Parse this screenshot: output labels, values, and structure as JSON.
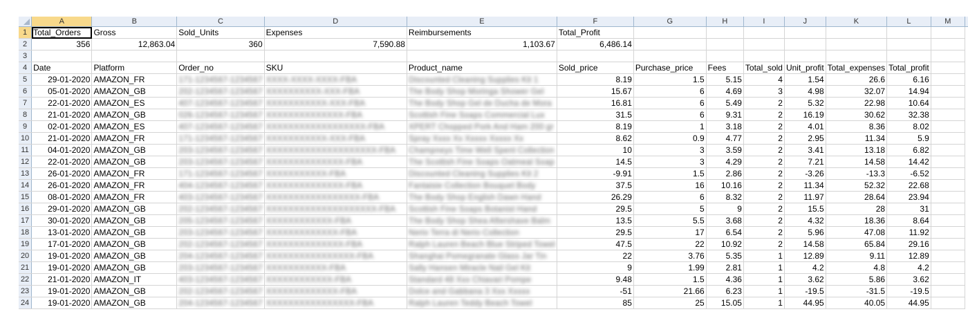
{
  "columns": [
    "A",
    "B",
    "C",
    "D",
    "E",
    "F",
    "G",
    "H",
    "I",
    "J",
    "K",
    "L",
    "M"
  ],
  "summary": {
    "headers": [
      "Total_Orders",
      "Gross",
      "Sold_Units",
      "Expenses",
      "Reimbursements",
      "Total_Profit"
    ],
    "values": [
      "356",
      "12,863.04",
      "360",
      "7,590.88",
      "1,103.67",
      "6,486.14"
    ]
  },
  "table": {
    "headers": [
      "Date",
      "Platform",
      "Order_no",
      "SKU",
      "Product_name",
      "Sold_price",
      "Purchase_price",
      "Fees",
      "Total_sold",
      "Unit_profit",
      "Total_expenses",
      "Total_profit"
    ],
    "rows": [
      {
        "date": "29-01-2020",
        "platform": "AMAZON_FR",
        "order": "171-1234567-1234567",
        "sku": "XXXX-XXXX-XXXX-FBA",
        "product": "Discounted Cleaning Supplies Kit 1",
        "sold": "8.19",
        "purchase": "1.5",
        "fees": "5.15",
        "total_sold": "4",
        "unit_profit": "1.54",
        "total_exp": "26.6",
        "total_profit": "6.16"
      },
      {
        "date": "05-01-2020",
        "platform": "AMAZON_GB",
        "order": "202-1234567-1234567",
        "sku": "XXXXXXXXXX-XXX-FBA",
        "product": "The Body Shop Moringa Shower Gel",
        "sold": "15.67",
        "purchase": "6",
        "fees": "4.69",
        "total_sold": "3",
        "unit_profit": "4.98",
        "total_exp": "32.07",
        "total_profit": "14.94"
      },
      {
        "date": "22-01-2020",
        "platform": "AMAZON_ES",
        "order": "407-1234567-1234567",
        "sku": "XXXXXXXXXXX-XXX-FBA",
        "product": "The Body Shop Gel de Ducha de Mora",
        "sold": "16.81",
        "purchase": "6",
        "fees": "5.49",
        "total_sold": "2",
        "unit_profit": "5.32",
        "total_exp": "22.98",
        "total_profit": "10.64"
      },
      {
        "date": "21-01-2020",
        "platform": "AMAZON_GB",
        "order": "026-1234567-1234567",
        "sku": "XXXXXXXXXXXXXX-FBA",
        "product": "Scottish Fine Soaps Commercial Lux",
        "sold": "31.5",
        "purchase": "6",
        "fees": "9.31",
        "total_sold": "2",
        "unit_profit": "16.19",
        "total_exp": "30.62",
        "total_profit": "32.38"
      },
      {
        "date": "02-01-2020",
        "platform": "AMAZON_ES",
        "order": "407-1234567-1234567",
        "sku": "XXXXXXXXXXXXXXXXXX-FBA",
        "product": "XPERT Chopped Pork And Ham 200 gr",
        "sold": "8.19",
        "purchase": "1",
        "fees": "3.18",
        "total_sold": "2",
        "unit_profit": "4.01",
        "total_exp": "8.36",
        "total_profit": "8.02"
      },
      {
        "date": "21-01-2020",
        "platform": "AMAZON_FR",
        "order": "171-1234567-1234567",
        "sku": "XXXXXXXXXXX-XXX-FBA",
        "product": "Spray Xxxx Xx Xxxxx Xxxxx Xx",
        "sold": "8.62",
        "purchase": "0.9",
        "fees": "4.77",
        "total_sold": "2",
        "unit_profit": "2.95",
        "total_exp": "11.34",
        "total_profit": "5.9"
      },
      {
        "date": "04-01-2020",
        "platform": "AMAZON_GB",
        "order": "203-1234567-1234567",
        "sku": "XXXXXXXXXXXXXXXXXXXX-FBA",
        "product": "Champneys Time Well Spent Collection",
        "sold": "10",
        "purchase": "3",
        "fees": "3.59",
        "total_sold": "2",
        "unit_profit": "3.41",
        "total_exp": "13.18",
        "total_profit": "6.82"
      },
      {
        "date": "22-01-2020",
        "platform": "AMAZON_GB",
        "order": "203-1234567-1234567",
        "sku": "XXXXXXXXXXXXXX-FBA",
        "product": "The Scottish Fine Soaps Oatmeal Soap",
        "sold": "14.5",
        "purchase": "3",
        "fees": "4.29",
        "total_sold": "2",
        "unit_profit": "7.21",
        "total_exp": "14.58",
        "total_profit": "14.42"
      },
      {
        "date": "26-01-2020",
        "platform": "AMAZON_FR",
        "order": "171-1234567-1234567",
        "sku": "XXXXXXXXXXX-FBA",
        "product": "Discounted Cleaning Supplies Kit 2",
        "sold": "-9.91",
        "purchase": "1.5",
        "fees": "2.86",
        "total_sold": "2",
        "unit_profit": "-3.26",
        "total_exp": "-13.3",
        "total_profit": "-6.52"
      },
      {
        "date": "26-01-2020",
        "platform": "AMAZON_FR",
        "order": "404-1234567-1234567",
        "sku": "XXXXXXXXXXXXXX-FBA",
        "product": "Fantaisie Collection Bouquet Body",
        "sold": "37.5",
        "purchase": "16",
        "fees": "10.16",
        "total_sold": "2",
        "unit_profit": "11.34",
        "total_exp": "52.32",
        "total_profit": "22.68"
      },
      {
        "date": "08-01-2020",
        "platform": "AMAZON_FR",
        "order": "403-1234567-1234567",
        "sku": "XXXXXXXXXXXXXXXXX-FBA",
        "product": "The Body Shop English Dawn Hand",
        "sold": "26.29",
        "purchase": "6",
        "fees": "8.32",
        "total_sold": "2",
        "unit_profit": "11.97",
        "total_exp": "28.64",
        "total_profit": "23.94"
      },
      {
        "date": "29-01-2020",
        "platform": "AMAZON_GB",
        "order": "202-1234567-1234567",
        "sku": "XXXXXXXXXXXXXXXXXXXX-FBA",
        "product": "Scottish Fine Soaps Botanist Hand",
        "sold": "29.5",
        "purchase": "5",
        "fees": "9",
        "total_sold": "2",
        "unit_profit": "15.5",
        "total_exp": "28",
        "total_profit": "31"
      },
      {
        "date": "30-01-2020",
        "platform": "AMAZON_GB",
        "order": "205-1234567-1234567",
        "sku": "XXXXXXXXXXXX-FBA",
        "product": "The Body Shop Shea Aftershave Balm",
        "sold": "13.5",
        "purchase": "5.5",
        "fees": "3.68",
        "total_sold": "2",
        "unit_profit": "4.32",
        "total_exp": "18.36",
        "total_profit": "8.64"
      },
      {
        "date": "13-01-2020",
        "platform": "AMAZON_GB",
        "order": "203-1234567-1234567",
        "sku": "XXXXXXXXXXXXX-FBA",
        "product": "Nerio Terra di Nerio Collection",
        "sold": "29.5",
        "purchase": "17",
        "fees": "6.54",
        "total_sold": "2",
        "unit_profit": "5.96",
        "total_exp": "47.08",
        "total_profit": "11.92"
      },
      {
        "date": "17-01-2020",
        "platform": "AMAZON_GB",
        "order": "202-1234567-1234567",
        "sku": "XXXXXXXXXXXXXX-FBA",
        "product": "Ralph Lauren Beach Blue Striped Towel",
        "sold": "47.5",
        "purchase": "22",
        "fees": "10.92",
        "total_sold": "2",
        "unit_profit": "14.58",
        "total_exp": "65.84",
        "total_profit": "29.16"
      },
      {
        "date": "19-01-2020",
        "platform": "AMAZON_GB",
        "order": "204-1234567-1234567",
        "sku": "XXXXXXXXXXXXXXXX-FBA",
        "product": "Shanghai Pomegranate Glass Jar Tin",
        "sold": "22",
        "purchase": "3.76",
        "fees": "5.35",
        "total_sold": "1",
        "unit_profit": "12.89",
        "total_exp": "9.11",
        "total_profit": "12.89"
      },
      {
        "date": "19-01-2020",
        "platform": "AMAZON_GB",
        "order": "203-1234567-1234567",
        "sku": "XXXXXXXXXXX-FBA",
        "product": "Sally Hansen Miracle Nail Gel Kit",
        "sold": "9",
        "purchase": "1.99",
        "fees": "2.81",
        "total_sold": "1",
        "unit_profit": "4.2",
        "total_exp": "4.8",
        "total_profit": "4.2"
      },
      {
        "date": "21-01-2020",
        "platform": "AMAZON_IT",
        "order": "403-1234567-1234567",
        "sku": "XXXXXXXXXXXX-FBA",
        "product": "Standard 48 Xxx Chiavari Pompe",
        "sold": "9.48",
        "purchase": "1.5",
        "fees": "4.36",
        "total_sold": "1",
        "unit_profit": "3.62",
        "total_exp": "5.86",
        "total_profit": "3.62"
      },
      {
        "date": "19-01-2020",
        "platform": "AMAZON_GB",
        "order": "202-1234567-1234567",
        "sku": "XXXXXXXXXXXXX-FBA",
        "product": "Dolce and Gabbana 3 Xxx Xxxxx",
        "sold": "-51",
        "purchase": "21.66",
        "fees": "6.23",
        "total_sold": "1",
        "unit_profit": "-19.5",
        "total_exp": "-31.5",
        "total_profit": "-19.5"
      },
      {
        "date": "19-01-2020",
        "platform": "AMAZON_GB",
        "order": "204-1234567-1234567",
        "sku": "XXXXXXXXXXXXXXXX-FBA",
        "product": "Ralph Lauren Teddy Beach Towel",
        "sold": "85",
        "purchase": "25",
        "fees": "15.05",
        "total_sold": "1",
        "unit_profit": "44.95",
        "total_exp": "40.05",
        "total_profit": "44.95"
      }
    ]
  }
}
